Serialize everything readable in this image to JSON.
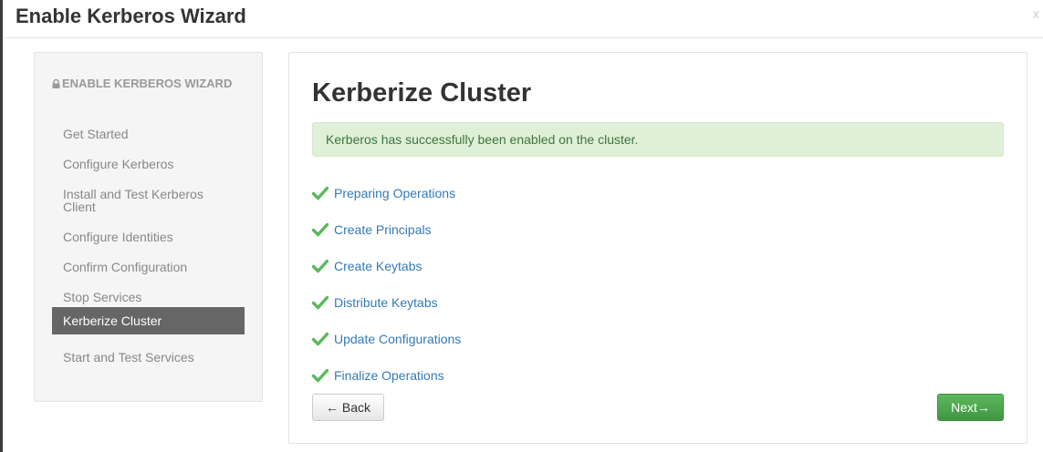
{
  "modal": {
    "title": "Enable Kerberos Wizard",
    "close_label": "x"
  },
  "sidebar": {
    "header": "ENABLE KERBEROS WIZARD",
    "header_icon": "lock-icon",
    "items": [
      {
        "label": "Get Started",
        "active": false
      },
      {
        "label": "Configure Kerberos",
        "active": false
      },
      {
        "label": "Install and Test Kerberos Client",
        "active": false
      },
      {
        "label": "Configure Identities",
        "active": false
      },
      {
        "label": "Confirm Configuration",
        "active": false
      },
      {
        "label": "Stop Services",
        "active": false
      },
      {
        "label": "Kerberize Cluster",
        "active": true
      },
      {
        "label": "Start and Test Services",
        "active": false
      }
    ]
  },
  "main": {
    "title": "Kerberize Cluster",
    "alert": "Kerberos has successfully been enabled on the cluster.",
    "tasks": [
      {
        "label": "Preparing Operations",
        "status": "done",
        "icon": "check-icon"
      },
      {
        "label": "Create Principals",
        "status": "done",
        "icon": "check-icon"
      },
      {
        "label": "Create Keytabs",
        "status": "done",
        "icon": "check-icon"
      },
      {
        "label": "Distribute Keytabs",
        "status": "done",
        "icon": "check-icon"
      },
      {
        "label": "Update Configurations",
        "status": "done",
        "icon": "check-icon"
      },
      {
        "label": "Finalize Operations",
        "status": "done",
        "icon": "check-icon"
      }
    ],
    "back_label": "← Back",
    "next_label": "Next→"
  },
  "colors": {
    "link": "#337ab7",
    "success_check": "#5cb85c",
    "alert_bg": "#dff0d8",
    "active_nav_bg": "#666666",
    "next_button": "#5cb85c"
  }
}
